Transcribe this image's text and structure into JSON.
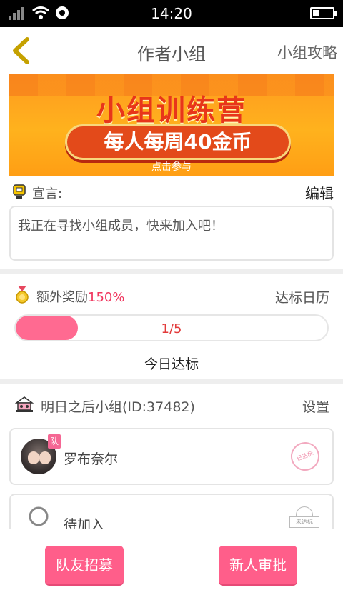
{
  "status_bar": {
    "time": "14:20"
  },
  "nav": {
    "title": "作者小组",
    "right_link": "小组攻略"
  },
  "banner": {
    "title": "小组训练营",
    "subtitle": "每人每周40金币",
    "cta": "点击参与"
  },
  "declaration": {
    "label": "宣言:",
    "edit": "编辑",
    "text": "我正在寻找小组成员，快来加入吧！"
  },
  "bonus": {
    "label": "额外奖励",
    "percent": "150%",
    "calendar": "达标日历"
  },
  "progress": {
    "text": "1/5",
    "fraction": 0.2,
    "caption": "今日达标"
  },
  "group": {
    "name": "明日之后小组(ID:37482)",
    "settings": "设置"
  },
  "members": [
    {
      "name": "罗布奈尔",
      "badge": "队",
      "stamp": "已达标"
    },
    {
      "name": "待加入",
      "stamp": "未达标"
    }
  ],
  "buttons": {
    "recruit": "队友招募",
    "approve": "新人审批"
  },
  "colors": {
    "accent": "#ff5e8a",
    "bonus_percent": "#f0375f"
  }
}
